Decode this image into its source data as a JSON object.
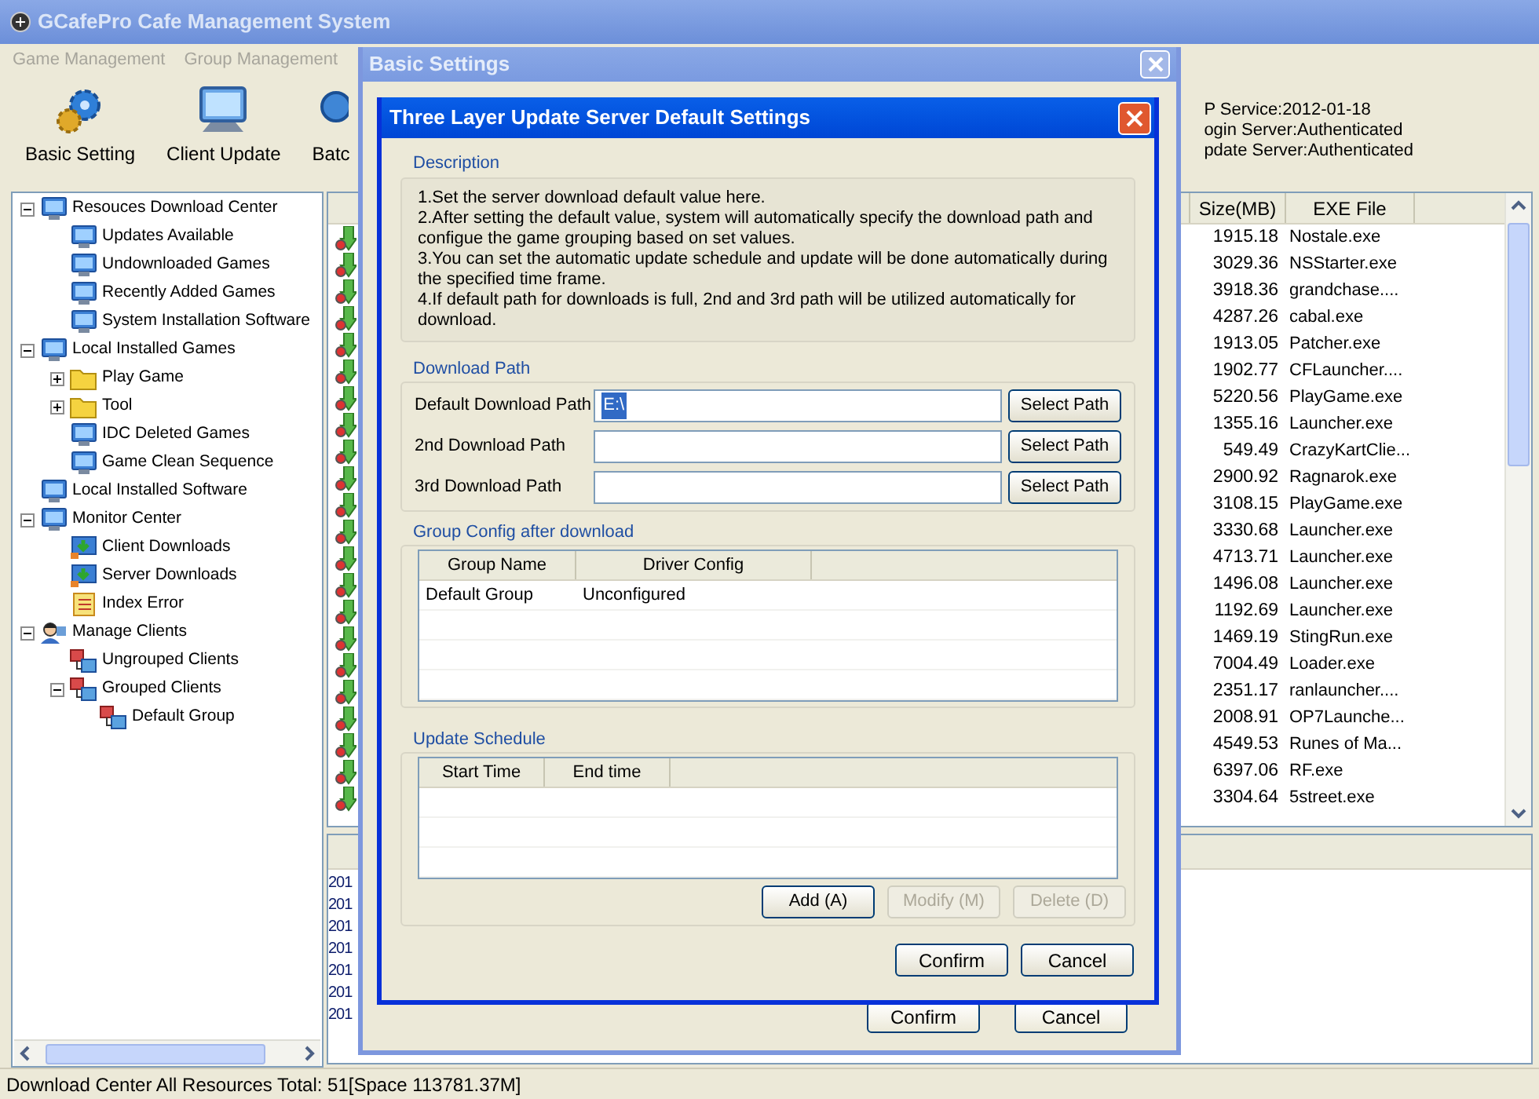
{
  "main_window": {
    "title": "GCafePro Cafe Management System",
    "menu": [
      "Game Management",
      "Group Management"
    ],
    "toolbar": [
      {
        "label": "Basic Setting",
        "kind": "gear"
      },
      {
        "label": "Client Update",
        "kind": "monitor"
      },
      {
        "label": "Batc",
        "kind": "globe"
      }
    ],
    "server_info": [
      "P Service:2012-01-18",
      "ogin Server:Authenticated",
      "pdate Server:Authenticated"
    ]
  },
  "tree": [
    {
      "label": "Resouces Download Center",
      "kind": "monitor",
      "expanded": true,
      "children": [
        {
          "label": "Updates Available",
          "kind": "monitor"
        },
        {
          "label": "Undownloaded Games",
          "kind": "monitor"
        },
        {
          "label": "Recently Added Games",
          "kind": "monitor"
        },
        {
          "label": "System Installation Software",
          "kind": "monitor"
        }
      ]
    },
    {
      "label": "Local Installed Games",
      "kind": "monitor",
      "expanded": true,
      "children": [
        {
          "label": "Play Game",
          "kind": "folder",
          "expanded": false
        },
        {
          "label": "Tool",
          "kind": "folder",
          "expanded": false
        },
        {
          "label": "IDC Deleted Games",
          "kind": "monitor"
        },
        {
          "label": "Game Clean Sequence",
          "kind": "monitor"
        }
      ]
    },
    {
      "label": "Local Installed Software",
      "kind": "monitor"
    },
    {
      "label": "Monitor Center",
      "kind": "monitor",
      "expanded": true,
      "children": [
        {
          "label": "Client Downloads",
          "kind": "download"
        },
        {
          "label": "Server Downloads",
          "kind": "download"
        },
        {
          "label": "Index Error",
          "kind": "list"
        }
      ]
    },
    {
      "label": "Manage Clients",
      "kind": "person",
      "expanded": true,
      "children": [
        {
          "label": "Ungrouped Clients",
          "kind": "network"
        },
        {
          "label": "Grouped Clients",
          "kind": "network",
          "expanded": true,
          "children": [
            {
              "label": "Default Group",
              "kind": "network"
            }
          ]
        }
      ]
    }
  ],
  "resource_list": {
    "columns": [
      "Size(MB)",
      "EXE File"
    ],
    "rows": [
      [
        "1915.18",
        "Nostale.exe"
      ],
      [
        "3029.36",
        "NSStarter.exe"
      ],
      [
        "3918.36",
        "grandchase...."
      ],
      [
        "4287.26",
        "cabal.exe"
      ],
      [
        "1913.05",
        "Patcher.exe"
      ],
      [
        "1902.77",
        "CFLauncher...."
      ],
      [
        "5220.56",
        "PlayGame.exe"
      ],
      [
        "1355.16",
        "Launcher.exe"
      ],
      [
        "549.49",
        "CrazyKartClie..."
      ],
      [
        "2900.92",
        "Ragnarok.exe"
      ],
      [
        "3108.15",
        "PlayGame.exe"
      ],
      [
        "3330.68",
        "Launcher.exe"
      ],
      [
        "4713.71",
        "Launcher.exe"
      ],
      [
        "1496.08",
        "Launcher.exe"
      ],
      [
        "1192.69",
        "Launcher.exe"
      ],
      [
        "1469.19",
        "StingRun.exe"
      ],
      [
        "7004.49",
        "Loader.exe"
      ],
      [
        "2351.17",
        "ranlauncher...."
      ],
      [
        "2008.91",
        "OP7Launche..."
      ],
      [
        "4549.53",
        "Runes of Ma..."
      ],
      [
        "6397.06",
        "RF.exe"
      ],
      [
        "3304.64",
        "5street.exe"
      ]
    ]
  },
  "log_rows": [
    "201",
    "201",
    "201",
    "201",
    "201",
    "201",
    "201"
  ],
  "status_bar": "Download Center All Resources Total: 51[Space 113781.37M]",
  "basic_settings": {
    "title": "Basic Settings",
    "buttons": [
      "Confirm",
      "Cancel"
    ]
  },
  "update_dialog": {
    "title": "Three Layer Update Server Default Settings",
    "description": {
      "label": "Description",
      "lines": [
        "1.Set the server download default value here.",
        "2.After setting the default value, system will automatically specify the download path and configue the game grouping based on set values.",
        "3.You can set the automatic update schedule and update will be done automatically during the specified time frame.",
        "4.If default path for downloads is full, 2nd and 3rd path will be utilized automatically for download."
      ]
    },
    "download_path": {
      "label": "Download Path",
      "rows": [
        {
          "label": "Default Download Path",
          "value": "E:\\",
          "value_selected": true,
          "button": "Select Path"
        },
        {
          "label": "2nd Download Path",
          "button": "Select Path"
        },
        {
          "label": "3rd Download Path",
          "button": "Select Path"
        }
      ]
    },
    "group_config": {
      "label": "Group Config after download",
      "columns": [
        "Group Name",
        "Driver Config"
      ],
      "rows": [
        [
          "Default Group",
          "Unconfigured"
        ]
      ]
    },
    "update_schedule": {
      "label": "Update Schedule",
      "columns": [
        "Start Time",
        "End time"
      ],
      "buttons": [
        {
          "label": "Add (A)",
          "disabled": false
        },
        {
          "label": "Modify (M)",
          "disabled": true
        },
        {
          "label": "Delete (D)",
          "disabled": true
        }
      ]
    },
    "buttons": [
      "Confirm",
      "Cancel"
    ]
  }
}
